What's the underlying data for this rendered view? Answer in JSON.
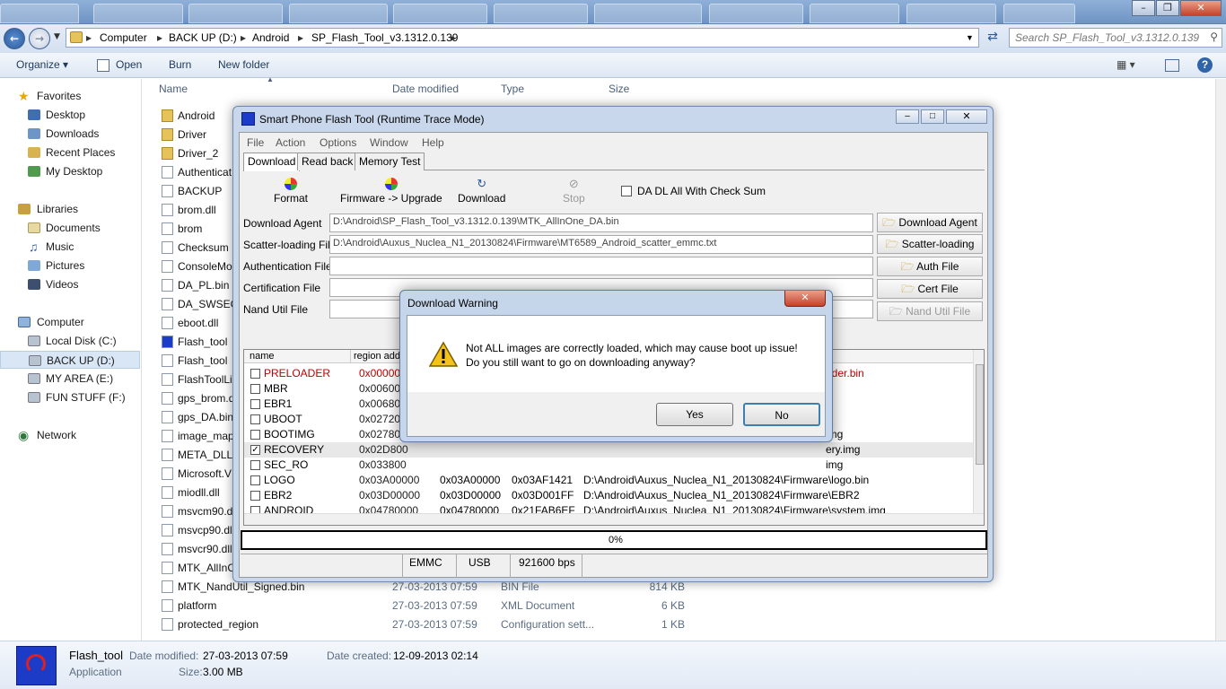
{
  "explorer": {
    "breadcrumb": [
      "Computer",
      "BACK UP (D:)",
      "Android",
      "SP_Flash_Tool_v3.1312.0.139"
    ],
    "search_placeholder": "Search SP_Flash_Tool_v3.1312.0.139",
    "toolbar": {
      "organize": "Organize",
      "open": "Open",
      "burn": "Burn",
      "new_folder": "New folder"
    },
    "nav": {
      "favorites": "Favorites",
      "favorites_items": [
        "Desktop",
        "Downloads",
        "Recent Places",
        "My Desktop"
      ],
      "libraries": "Libraries",
      "libraries_items": [
        "Documents",
        "Music",
        "Pictures",
        "Videos"
      ],
      "computer": "Computer",
      "drives": [
        "Local Disk (C:)",
        "BACK UP (D:)",
        "MY AREA (E:)",
        "FUN STUFF (F:)"
      ],
      "network": "Network"
    },
    "columns": {
      "name": "Name",
      "date": "Date modified",
      "type": "Type",
      "size": "Size"
    },
    "files": [
      {
        "name": "Android"
      },
      {
        "name": "Driver"
      },
      {
        "name": "Driver_2"
      },
      {
        "name": "Authenticat"
      },
      {
        "name": "BACKUP"
      },
      {
        "name": "brom.dll"
      },
      {
        "name": "brom"
      },
      {
        "name": "Checksum"
      },
      {
        "name": "ConsoleMo"
      },
      {
        "name": "DA_PL.bin"
      },
      {
        "name": "DA_SWSEC."
      },
      {
        "name": "eboot.dll"
      },
      {
        "name": "Flash_tool"
      },
      {
        "name": "Flash_tool"
      },
      {
        "name": "FlashToolLi"
      },
      {
        "name": "gps_brom.d"
      },
      {
        "name": "gps_DA.bin"
      },
      {
        "name": "image_map"
      },
      {
        "name": "META_DLL."
      },
      {
        "name": "Microsoft.V"
      },
      {
        "name": "miodll.dll"
      },
      {
        "name": "msvcm90.dl"
      },
      {
        "name": "msvcp90.dl"
      },
      {
        "name": "msvcr90.dll"
      },
      {
        "name": "MTK_AllInC"
      },
      {
        "name": "MTK_NandUtil_Signed.bin",
        "date": "27-03-2013 07:59",
        "type": "BIN File",
        "size": "814 KB"
      },
      {
        "name": "platform",
        "date": "27-03-2013 07:59",
        "type": "XML Document",
        "size": "6 KB"
      },
      {
        "name": "protected_region",
        "date": "27-03-2013 07:59",
        "type": "Configuration sett...",
        "size": "1 KB"
      }
    ],
    "details": {
      "name": "Flash_tool",
      "kind": "Application",
      "modified_label": "Date modified:",
      "modified": "27-03-2013 07:59",
      "size_label": "Size:",
      "size": "3.00 MB",
      "created_label": "Date created:",
      "created": "12-09-2013 02:14"
    }
  },
  "flash_tool": {
    "title": "Smart Phone Flash Tool (Runtime Trace Mode)",
    "menu": [
      "File",
      "Action",
      "Options",
      "Window",
      "Help"
    ],
    "tabs": [
      "Download",
      "Read back",
      "Memory Test"
    ],
    "tools": [
      "Format",
      "Firmware -> Upgrade",
      "Download",
      "Stop"
    ],
    "checksum_label": "DA DL All With Check Sum",
    "fields": [
      {
        "label": "Download Agent",
        "value": "D:\\Android\\SP_Flash_Tool_v3.1312.0.139\\MTK_AllInOne_DA.bin",
        "button": "Download Agent"
      },
      {
        "label": "Scatter-loading File",
        "value": "D:\\Android\\Auxus_Nuclea_N1_20130824\\Firmware\\MT6589_Android_scatter_emmc.txt",
        "button": "Scatter-loading"
      },
      {
        "label": "Authentication File",
        "value": "",
        "button": "Auth File"
      },
      {
        "label": "Certification File",
        "value": "",
        "button": "Cert File"
      },
      {
        "label": "Nand Util File",
        "value": "",
        "button": "Nand Util File"
      }
    ],
    "table_headers": [
      "name",
      "region add"
    ],
    "rows": [
      {
        "name": "PRELOADER",
        "begin": "0x000000",
        "end": "",
        "rend": "",
        "file": "ader.bin",
        "checked": false
      },
      {
        "name": "MBR",
        "begin": "0x006000",
        "end": "",
        "rend": "",
        "file": "",
        "checked": false
      },
      {
        "name": "EBR1",
        "begin": "0x006800",
        "end": "",
        "rend": "",
        "file": "",
        "checked": false
      },
      {
        "name": "UBOOT",
        "begin": "0x027200",
        "end": "",
        "rend": "",
        "file": "",
        "checked": false
      },
      {
        "name": "BOOTIMG",
        "begin": "0x027800",
        "end": "",
        "rend": "",
        "file": "img",
        "checked": false
      },
      {
        "name": "RECOVERY",
        "begin": "0x02D800",
        "end": "",
        "rend": "",
        "file": "ery.img",
        "checked": true
      },
      {
        "name": "SEC_RO",
        "begin": "0x033800",
        "end": "",
        "rend": "",
        "file": "img",
        "checked": false
      },
      {
        "name": "LOGO",
        "begin": "0x03A00000",
        "end": "0x03A00000",
        "rend": "0x03AF1421",
        "file": "D:\\Android\\Auxus_Nuclea_N1_20130824\\Firmware\\logo.bin",
        "checked": false
      },
      {
        "name": "EBR2",
        "begin": "0x03D00000",
        "end": "0x03D00000",
        "rend": "0x03D001FF",
        "file": "D:\\Android\\Auxus_Nuclea_N1_20130824\\Firmware\\EBR2",
        "checked": false
      },
      {
        "name": "ANDROID",
        "begin": "0x04780000",
        "end": "0x04780000",
        "rend": "0x21FAB6EF",
        "file": "D:\\Android\\Auxus_Nuclea_N1_20130824\\Firmware\\system.img",
        "checked": false
      }
    ],
    "progress": "0%",
    "progress_value": 0,
    "status": [
      "EMMC",
      "USB",
      "921600 bps"
    ]
  },
  "dialog": {
    "title": "Download Warning",
    "line1": "Not ALL images are correctly loaded, which may cause boot up issue!",
    "line2": "Do you still want to go on downloading anyway?",
    "yes": "Yes",
    "no": "No"
  },
  "colors": {
    "warning_row_text": "#c00000",
    "selected_drive_bg": "#d9e6f5"
  }
}
